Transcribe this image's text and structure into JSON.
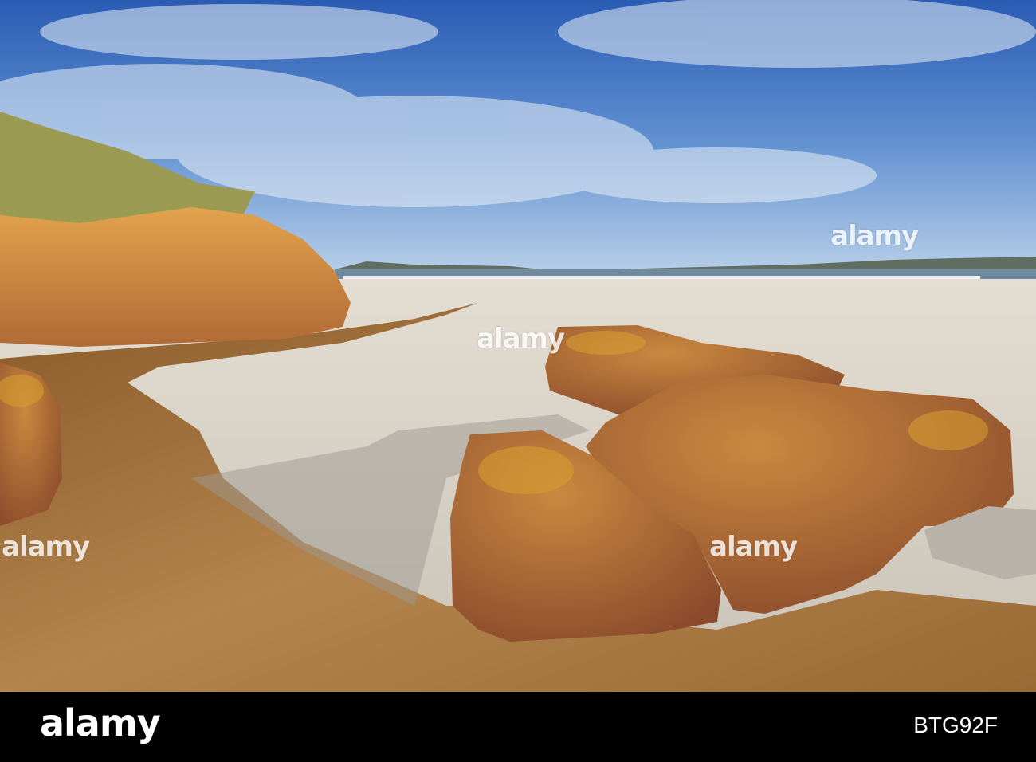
{
  "photo": {
    "subject": "Beach with granite rocks",
    "watermark": "alamy"
  },
  "footer": {
    "logo": "alamy",
    "image_code": "BTG92F"
  },
  "colors": {
    "sky_top": "#2f63b8",
    "sky_horizon": "#a9c6e6",
    "sand": "#d9d3c8",
    "water": "#a8763a",
    "rock": "#b0683a",
    "lichen": "#d9a030",
    "bar": "#000000"
  }
}
